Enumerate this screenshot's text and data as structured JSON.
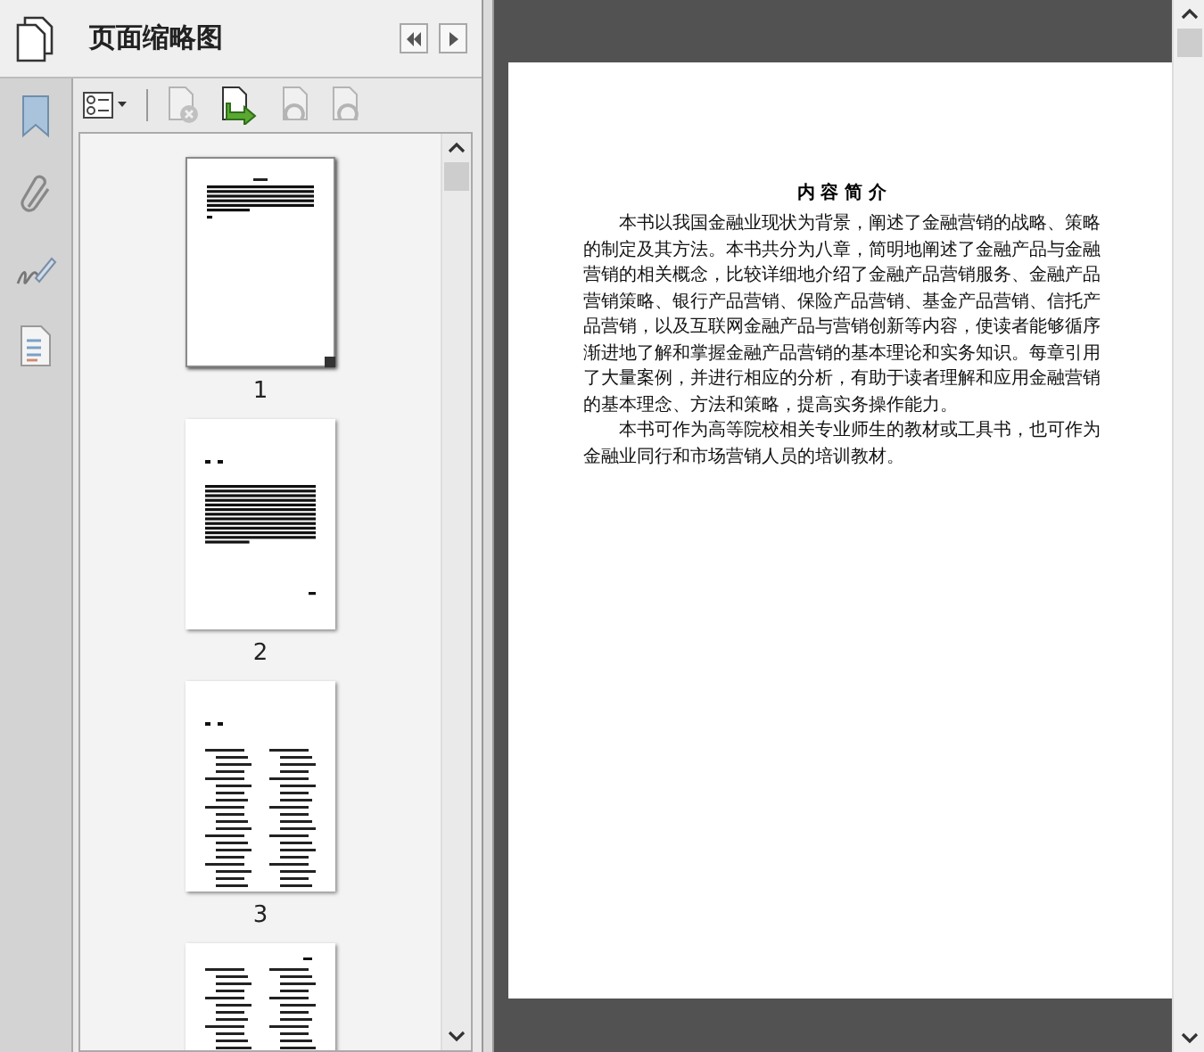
{
  "panel": {
    "title": "页面缩略图"
  },
  "tools": [
    {
      "kind": "options",
      "disabled": false
    },
    {
      "kind": "delete",
      "disabled": true
    },
    {
      "kind": "replace",
      "disabled": false
    },
    {
      "kind": "rotate-left",
      "disabled": true
    },
    {
      "kind": "rotate-right",
      "disabled": true
    }
  ],
  "thumbnails": [
    {
      "kind": "summary",
      "label": "1",
      "selected": true
    },
    {
      "kind": "preface",
      "label": "2",
      "selected": false
    },
    {
      "kind": "contents",
      "label": "3",
      "selected": false
    },
    {
      "kind": "contents-continued",
      "selected": false
    }
  ],
  "document": {
    "title": "内 容 简 介",
    "paragraphs": [
      "本书以我国金融业现状为背景，阐述了金融营销的战略、策略的制定及其方法。本书共分为八章，简明地阐述了金融产品与金融营销的相关概念，比较详细地介绍了金融产品营销服务、金融产品营销策略、银行产品营销、保险产品营销、基金产品营销、信托产品营销，以及互联网金融产品与营销创新等内容，使读者能够循序渐进地了解和掌握金融产品营销的基本理论和实务知识。每章引用了大量案例，并进行相应的分析，有助于读者理解和应用金融营销的基本理念、方法和策略，提高实务操作能力。",
      "本书可作为高等院校相关专业师生的教材或工具书，也可作为金融业同行和市场营销人员的培训教材。"
    ]
  }
}
